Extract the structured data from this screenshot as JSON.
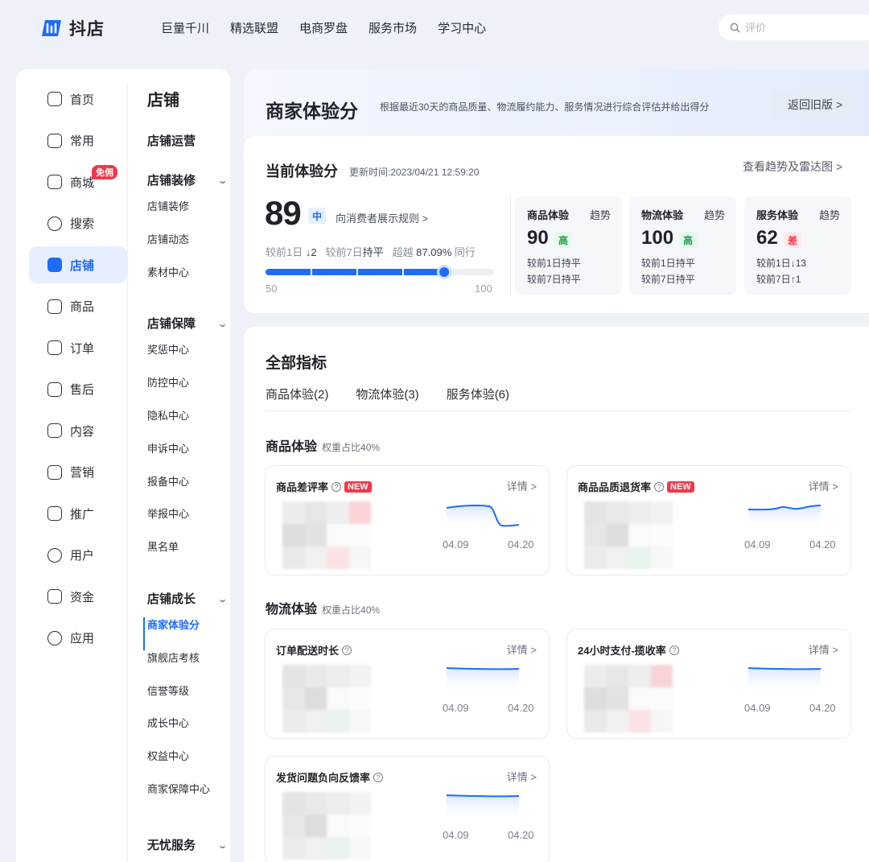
{
  "header": {
    "logo_text": "抖店",
    "nav": [
      "巨量千川",
      "精选联盟",
      "电商罗盘",
      "服务市场",
      "学习中心"
    ],
    "search_placeholder": "评价"
  },
  "sidebar": {
    "items": [
      {
        "label": "首页",
        "icon": "home-icon"
      },
      {
        "label": "常用",
        "icon": "folder-icon"
      },
      {
        "label": "商城",
        "icon": "mall-icon",
        "badge": "免佣"
      },
      {
        "label": "搜索",
        "icon": "search-icon"
      },
      {
        "label": "店铺",
        "icon": "store-icon",
        "active": true
      },
      {
        "label": "商品",
        "icon": "bag-icon"
      },
      {
        "label": "订单",
        "icon": "order-icon"
      },
      {
        "label": "售后",
        "icon": "aftersale-icon"
      },
      {
        "label": "内容",
        "icon": "tv-icon"
      },
      {
        "label": "营销",
        "icon": "megaphone-icon"
      },
      {
        "label": "推广",
        "icon": "send-icon"
      },
      {
        "label": "用户",
        "icon": "user-icon"
      },
      {
        "label": "资金",
        "icon": "wallet-icon"
      },
      {
        "label": "应用",
        "icon": "app-icon"
      }
    ]
  },
  "subnav": {
    "title": "店铺",
    "entries": [
      {
        "type": "group",
        "label": "店铺运营"
      },
      {
        "type": "group",
        "label": "店铺装修",
        "chevron": true
      },
      {
        "type": "link",
        "label": "店铺装修"
      },
      {
        "type": "link",
        "label": "店铺动态"
      },
      {
        "type": "link",
        "label": "素材中心"
      },
      {
        "type": "group",
        "label": "店铺保障",
        "chevron": true
      },
      {
        "type": "link",
        "label": "奖惩中心"
      },
      {
        "type": "link",
        "label": "防控中心"
      },
      {
        "type": "link",
        "label": "隐私中心"
      },
      {
        "type": "link",
        "label": "申诉中心"
      },
      {
        "type": "link",
        "label": "报备中心"
      },
      {
        "type": "link",
        "label": "举报中心"
      },
      {
        "type": "link",
        "label": "黑名单"
      },
      {
        "type": "group",
        "label": "店铺成长",
        "chevron": true
      },
      {
        "type": "link",
        "label": "商家体验分",
        "active": true
      },
      {
        "type": "link",
        "label": "旗舰店考核"
      },
      {
        "type": "link",
        "label": "信誉等级"
      },
      {
        "type": "link",
        "label": "成长中心"
      },
      {
        "type": "link",
        "label": "权益中心"
      },
      {
        "type": "link",
        "label": "商家保障中心"
      },
      {
        "type": "group",
        "label": "无忧服务",
        "chevron": true
      }
    ]
  },
  "hero": {
    "title": "商家体验分",
    "desc": "根据最近30天的商品质量、物流履约能力、服务情况进行综合评估并给出得分",
    "back_button": "返回旧版 >"
  },
  "score": {
    "title": "当前体验分",
    "updated": "更新时间:2023/04/21 12:59:20",
    "trend_link": "查看趋势及雷达图 >",
    "value": "89",
    "level": "中",
    "rule_link": "向消费者展示规则 >",
    "cmp_day": "较前1日",
    "cmp_day_val": "↓2",
    "cmp_week": "较前7日",
    "cmp_week_val": "持平",
    "beat": "超越",
    "beat_val": "87.09%",
    "beat_suffix": "同行",
    "bar_min": "50",
    "bar_max": "100",
    "bar_fraction": 0.78,
    "sub_scores": [
      {
        "name": "商品体验",
        "trend": "趋势",
        "value": "90",
        "level": "高",
        "level_kind": "high",
        "c1_label": "较前1日",
        "c1_val": "持平",
        "c2_label": "较前7日",
        "c2_val": "持平"
      },
      {
        "name": "物流体验",
        "trend": "趋势",
        "value": "100",
        "level": "高",
        "level_kind": "high",
        "c1_label": "较前1日",
        "c1_val": "持平",
        "c2_label": "较前7日",
        "c2_val": "持平"
      },
      {
        "name": "服务体验",
        "trend": "趋势",
        "value": "62",
        "level": "差",
        "level_kind": "low",
        "c1_label": "较前1日",
        "c1_val": "↓13",
        "c2_label": "较前7日",
        "c2_val": "↑1"
      }
    ]
  },
  "metrics": {
    "title": "全部指标",
    "tabs": [
      "商品体验(2)",
      "物流体验(3)",
      "服务体验(6)"
    ],
    "sections": [
      {
        "title": "商品体验",
        "weight": "权重占比40%",
        "cards": [
          {
            "name": "商品差评率",
            "new": "NEW",
            "detail": "详情 >",
            "d1": "04.09",
            "d2": "04.20",
            "shape": "drop"
          },
          {
            "name": "商品品质退货率",
            "new": "NEW",
            "detail": "详情 >",
            "d1": "04.09",
            "d2": "04.20",
            "shape": "wave"
          }
        ]
      },
      {
        "title": "物流体验",
        "weight": "权重占比40%",
        "cards": [
          {
            "name": "订单配送时长",
            "detail": "详情 >",
            "d1": "04.09",
            "d2": "04.20",
            "shape": "flat"
          },
          {
            "name": "24小时支付-揽收率",
            "detail": "详情 >",
            "d1": "04.09",
            "d2": "04.20",
            "shape": "flat"
          },
          {
            "name": "发货问题负向反馈率",
            "detail": "详情 >",
            "d1": "04.09",
            "d2": "04.20",
            "shape": "flat"
          }
        ]
      }
    ]
  },
  "colors": {
    "accent": "#1e6bff",
    "high": "#19a34a",
    "low": "#f5364a"
  }
}
